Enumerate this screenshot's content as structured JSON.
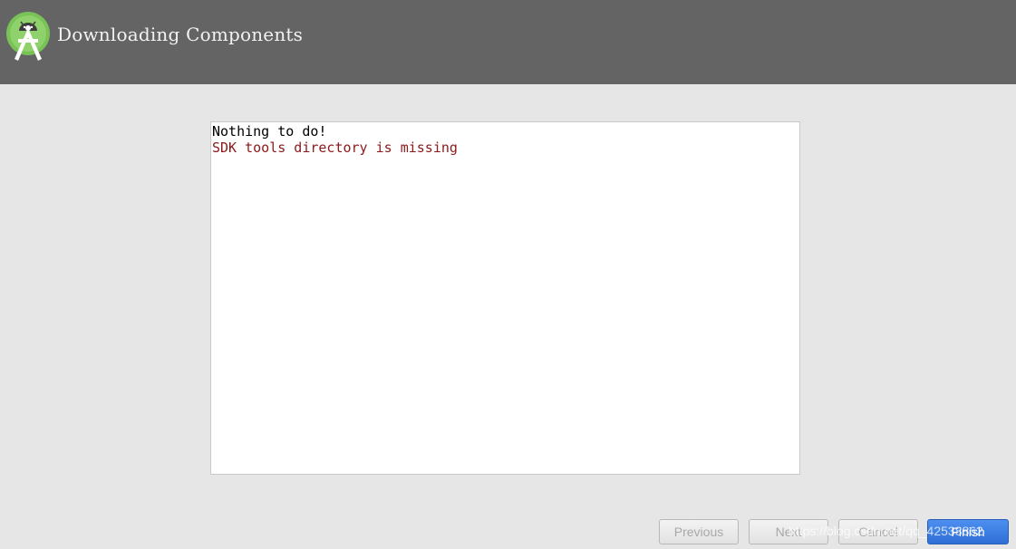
{
  "header": {
    "title": "Downloading Components",
    "logo_icon": "android-studio-logo-icon"
  },
  "log": {
    "lines": [
      {
        "text": "Nothing to do!",
        "kind": "info"
      },
      {
        "text": "SDK tools directory is missing",
        "kind": "error"
      }
    ]
  },
  "buttons": {
    "previous": "Previous",
    "next": "Next",
    "cancel": "Cancel",
    "finish": "Finish"
  },
  "watermark": "https://blog.csdn.net/qq_42538862",
  "colors": {
    "header_bg": "#646464",
    "page_bg": "#e6e6e6",
    "error_text": "#8b1a1a",
    "primary_button": "#3a7be0",
    "logo_green": "#78c257"
  }
}
